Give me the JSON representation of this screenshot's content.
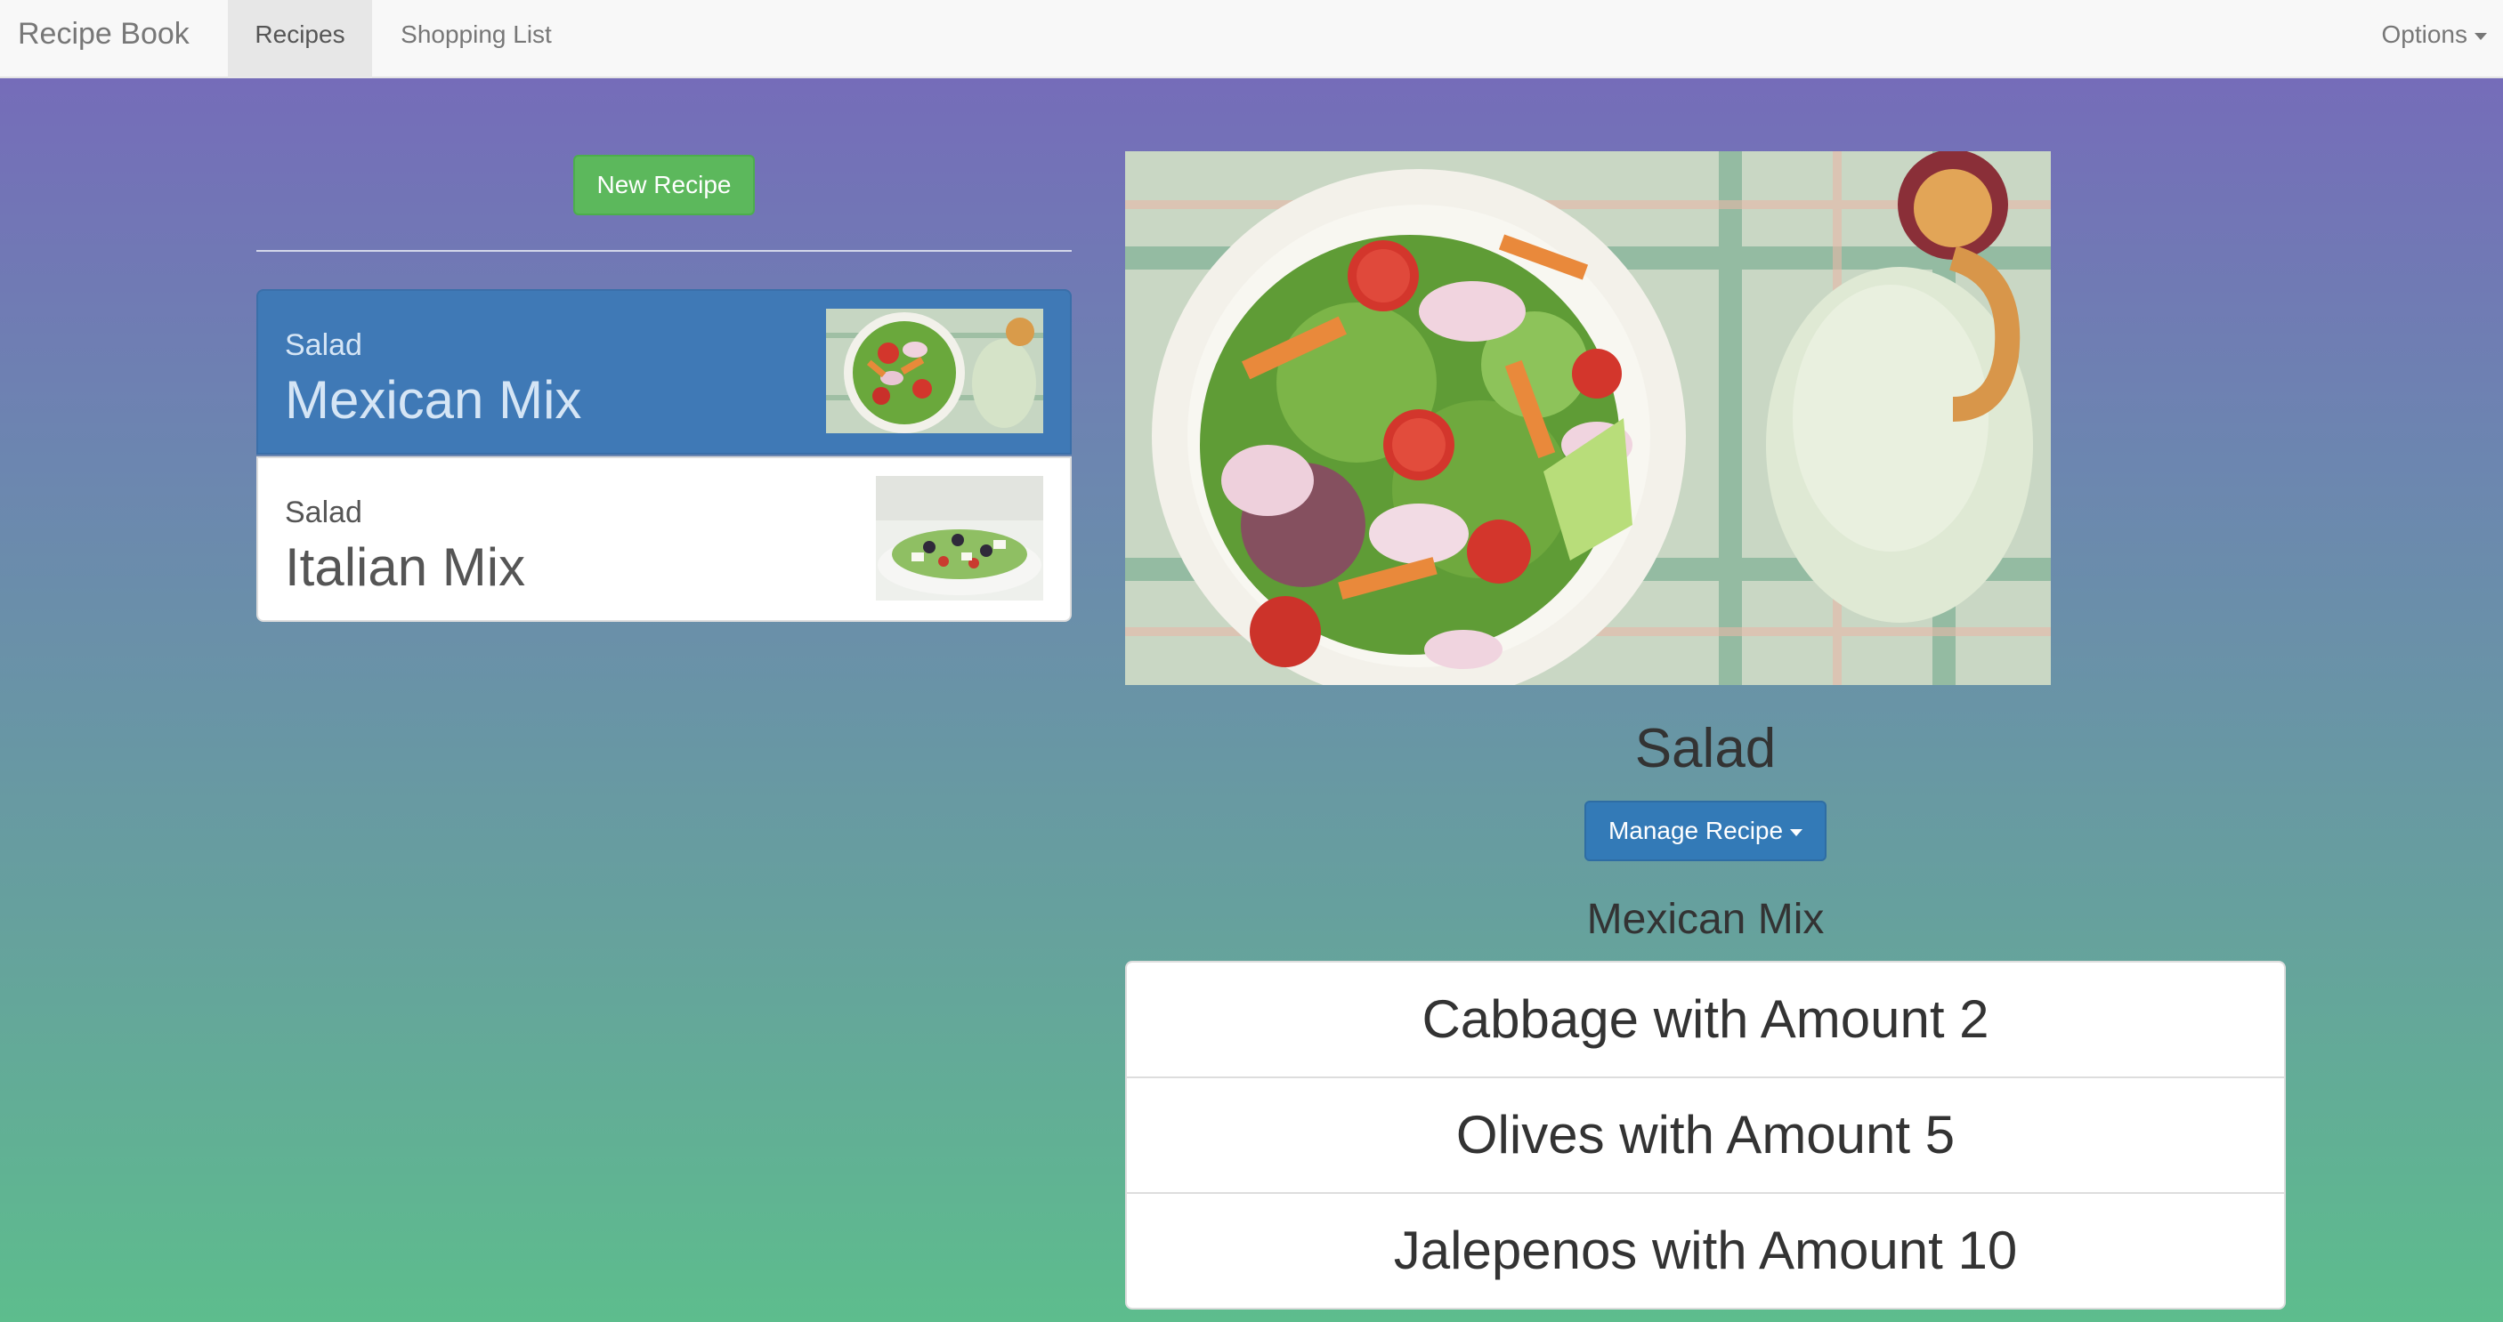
{
  "navbar": {
    "brand": "Recipe Book",
    "tabs": [
      {
        "label": "Recipes",
        "active": true
      },
      {
        "label": "Shopping List",
        "active": false
      }
    ],
    "options_label": "Options"
  },
  "recipe_list": {
    "new_recipe_label": "New Recipe",
    "items": [
      {
        "type": "Salad",
        "name": "Mexican Mix",
        "active": true
      },
      {
        "type": "Salad",
        "name": "Italian Mix",
        "active": false
      }
    ]
  },
  "recipe_detail": {
    "title": "Salad",
    "manage_label": "Manage Recipe",
    "description": "Mexican Mix",
    "ingredients": [
      "Cabbage with Amount 2",
      "Olives with Amount 5",
      "Jalepenos with Amount 10"
    ]
  },
  "colors": {
    "accent": "#337ab7",
    "success": "#5cb85c",
    "active_item": "#3f79b6"
  }
}
